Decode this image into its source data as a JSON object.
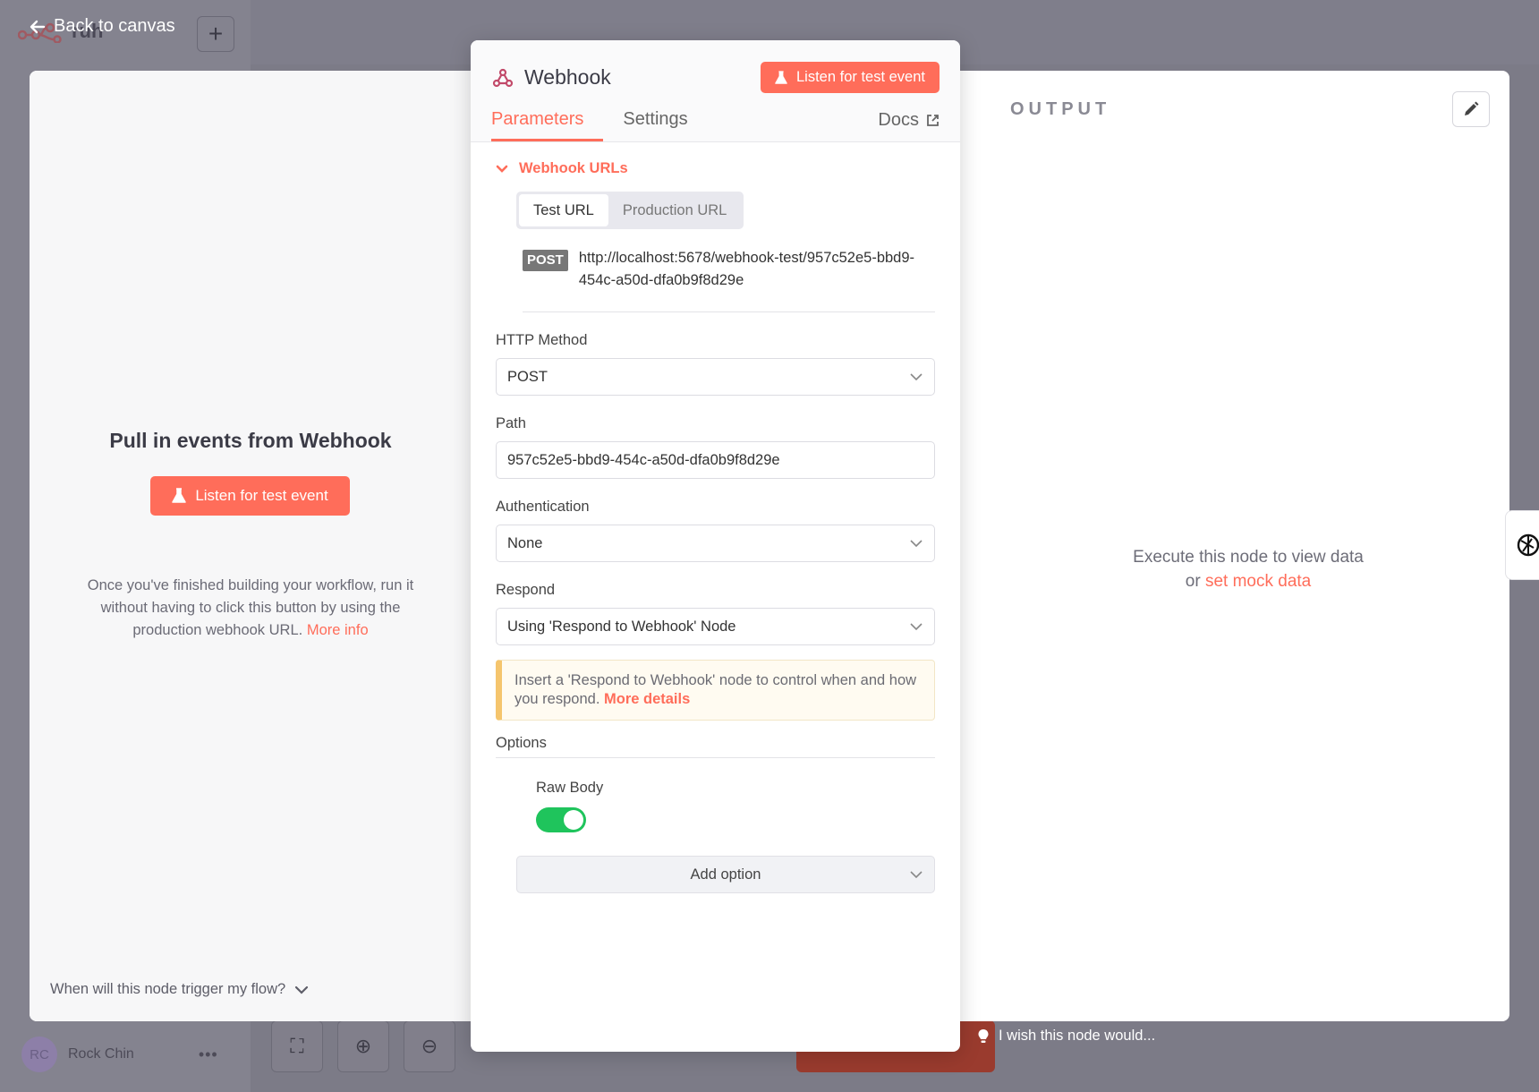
{
  "background": {
    "workflow_name": "ruh",
    "user_initials": "RC",
    "user_name": "Rock Chin"
  },
  "nav": {
    "back_label": "Back to canvas"
  },
  "input_panel": {
    "title": "Pull in events from Webhook",
    "listen_label": "Listen for test event",
    "description": "Once you've finished building your workflow, run it without having to click this button by using the production webhook URL.",
    "more_info": "More info",
    "trigger_question": "When will this node trigger my flow?"
  },
  "node": {
    "title": "Webhook",
    "listen_label": "Listen for test event",
    "tabs": [
      {
        "label": "Parameters"
      },
      {
        "label": "Settings"
      }
    ],
    "docs_label": "Docs",
    "webhook_urls_label": "Webhook URLs",
    "url_tabs": [
      {
        "label": "Test URL"
      },
      {
        "label": "Production URL"
      }
    ],
    "method_badge": "POST",
    "url": "http://localhost:5678/webhook-test/957c52e5-bbd9-454c-a50d-dfa0b9f8d29e",
    "http_method_label": "HTTP Method",
    "http_method_value": "POST",
    "path_label": "Path",
    "path_value": "957c52e5-bbd9-454c-a50d-dfa0b9f8d29e",
    "auth_label": "Authentication",
    "auth_value": "None",
    "respond_label": "Respond",
    "respond_value": "Using 'Respond to Webhook' Node",
    "notice_text": "Insert a 'Respond to Webhook' node to control when and how you respond.",
    "notice_link": "More details",
    "options_label": "Options",
    "raw_body_label": "Raw Body",
    "raw_body_on": true,
    "add_option_label": "Add option"
  },
  "output_panel": {
    "label": "OUTPUT",
    "msg_line1": "Execute this node to view data",
    "msg_or": "or",
    "mock_link": "set mock data"
  },
  "wish_label": "I wish this node would...",
  "colors": {
    "accent": "#ff6d5a",
    "toggle_on": "#1fc45c",
    "notice_border": "#f5c56d"
  }
}
